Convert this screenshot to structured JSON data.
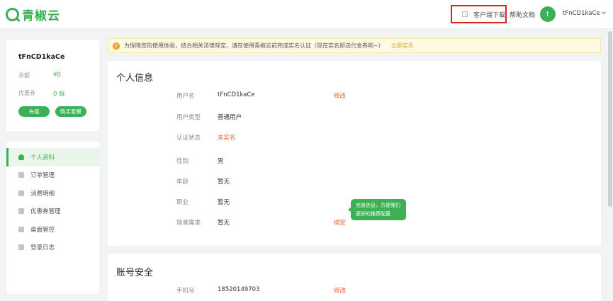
{
  "header": {
    "logo_text": "青椒云",
    "client_download": "客户端下载",
    "help_docs": "帮助文档",
    "avatar_letter": "t",
    "username": "tFnCD1kaCe"
  },
  "profile": {
    "name": "tFnCD1kaCe",
    "balance_label": "余额",
    "balance_value": "¥0",
    "coupon_label": "优惠券",
    "coupon_value": "0 张",
    "recharge_label": "充值",
    "buy_plan_label": "购买套餐"
  },
  "sidebar": {
    "items": [
      {
        "label": "个人资料",
        "icon": "user-icon",
        "active": true
      },
      {
        "label": "订单管理",
        "icon": "order-icon",
        "active": false
      },
      {
        "label": "消费明细",
        "icon": "bill-icon",
        "active": false
      },
      {
        "label": "优惠券管理",
        "icon": "coupon-icon",
        "active": false
      },
      {
        "label": "桌面管控",
        "icon": "desktop-icon",
        "active": false
      },
      {
        "label": "登录日志",
        "icon": "log-icon",
        "active": false
      }
    ]
  },
  "notice": {
    "text": "为保障您的使用体验，结合相关法律规定，请在使用青椒云前完成实名认证（现在实名即送代金券哟~）",
    "link": "立即实名"
  },
  "personal": {
    "title": "个人信息",
    "rows": [
      {
        "label": "用户名",
        "value": "tFnCD1kaCe",
        "action": "修改"
      },
      {
        "label": "用户类型",
        "value": "普通用户",
        "action": ""
      },
      {
        "label": "认证状态",
        "value": "未实名",
        "action": ""
      },
      {
        "label": "性别",
        "value": "男",
        "action": ""
      },
      {
        "label": "年龄",
        "value": "暂无",
        "action": ""
      },
      {
        "label": "职业",
        "value": "暂无",
        "action": ""
      },
      {
        "label": "场景需求",
        "value": "暂无",
        "action": "绑定"
      }
    ],
    "tooltip": "完善信息，方便我们更好的推荐配置"
  },
  "security": {
    "title": "账号安全",
    "phone_label": "手机号",
    "phone_value": "18520149703",
    "phone_action": "修改"
  },
  "colors": {
    "brand": "#3cb054",
    "warning": "#f0a020",
    "danger": "#e0612b",
    "highlight_box": "#e02020"
  }
}
